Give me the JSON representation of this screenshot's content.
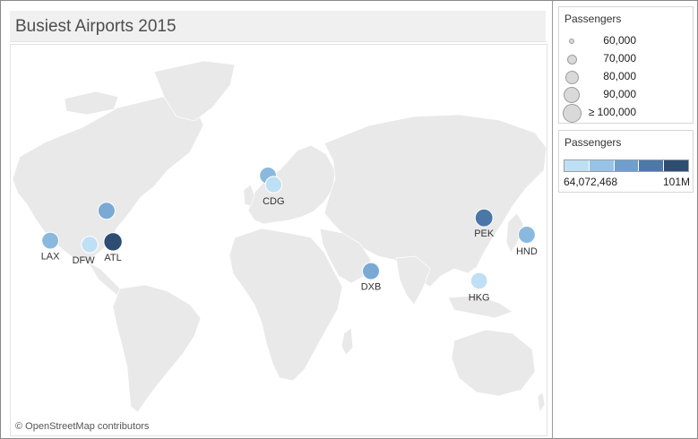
{
  "dashboard": {
    "title": "Busiest Airports 2015"
  },
  "map": {
    "attribution": "© OpenStreetMap contributors",
    "land_color": "#e9e9e9",
    "border_color": "#ffffff",
    "water_color": "#ffffff",
    "airports": [
      {
        "code": "ATL",
        "lon": -84.43,
        "lat": 33.64,
        "passengers_m": 101.5,
        "color": "#2d4d72",
        "show_label": true
      },
      {
        "code": "PEK",
        "lon": 116.6,
        "lat": 40.08,
        "passengers_m": 89.9,
        "color": "#4a77a8",
        "show_label": true
      },
      {
        "code": "DXB",
        "lon": 55.36,
        "lat": 25.25,
        "passengers_m": 78.0,
        "color": "#7aaad4",
        "show_label": true
      },
      {
        "code": "ORD",
        "lon": -87.9,
        "lat": 41.98,
        "passengers_m": 76.9,
        "color": "#7aaad4",
        "show_label": false
      },
      {
        "code": "HND",
        "lon": 139.78,
        "lat": 35.55,
        "passengers_m": 75.3,
        "color": "#8bb9de",
        "show_label": true
      },
      {
        "code": "LHR",
        "lon": -0.45,
        "lat": 51.47,
        "passengers_m": 75.0,
        "color": "#8bb9de",
        "show_label": false
      },
      {
        "code": "LAX",
        "lon": -118.41,
        "lat": 33.94,
        "passengers_m": 74.9,
        "color": "#8bb9de",
        "show_label": true
      },
      {
        "code": "HKG",
        "lon": 113.91,
        "lat": 22.31,
        "passengers_m": 68.5,
        "color": "#bfe0f4",
        "show_label": true
      },
      {
        "code": "CDG",
        "lon": 2.55,
        "lat": 49.01,
        "passengers_m": 65.8,
        "color": "#bfe0f4",
        "show_label": true
      },
      {
        "code": "DFW",
        "lon": -97.04,
        "lat": 32.9,
        "passengers_m": 65.5,
        "color": "#bfe0f4",
        "show_label": true
      }
    ]
  },
  "legend_size": {
    "title": "Passengers",
    "items": [
      {
        "label": "60,000",
        "diameter": 6
      },
      {
        "label": "70,000",
        "diameter": 11
      },
      {
        "label": "80,000",
        "diameter": 15
      },
      {
        "label": "90,000",
        "diameter": 18
      },
      {
        "label": "≥ 100,000",
        "diameter": 21
      }
    ]
  },
  "legend_color": {
    "title": "Passengers",
    "min_label": "64,072,468",
    "max_label": "101M",
    "steps": [
      "#bfe0f4",
      "#97c4e6",
      "#6f9fcc",
      "#4d79a8",
      "#2d4d72"
    ]
  }
}
